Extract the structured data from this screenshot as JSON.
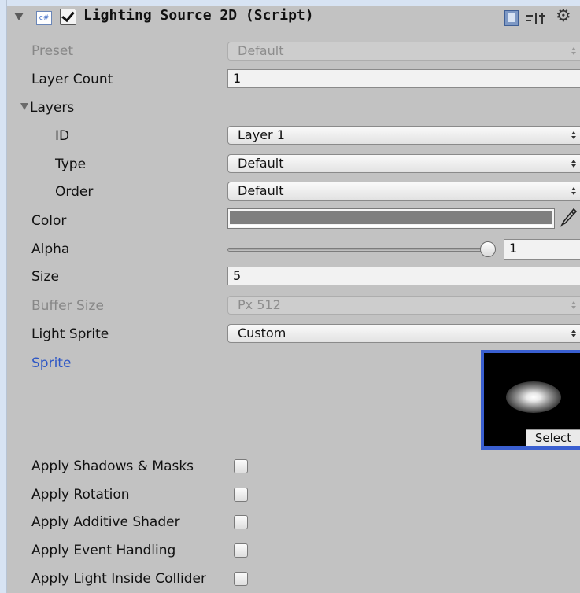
{
  "component": {
    "title": "Lighting Source 2D (Script)",
    "icon_text": "c#",
    "enabled": true
  },
  "fields": {
    "preset": {
      "label": "Preset",
      "value": "Default"
    },
    "layer_count": {
      "label": "Layer Count",
      "value": "1"
    },
    "layers": {
      "label": "Layers"
    },
    "id": {
      "label": "ID",
      "value": "Layer 1"
    },
    "type": {
      "label": "Type",
      "value": "Default"
    },
    "order": {
      "label": "Order",
      "value": "Default"
    },
    "color": {
      "label": "Color",
      "value": "#7f7f7f"
    },
    "alpha": {
      "label": "Alpha",
      "value": "1",
      "slider_fraction": 1.0
    },
    "size": {
      "label": "Size",
      "value": "5"
    },
    "buffer_size": {
      "label": "Buffer Size",
      "value": "Px 512"
    },
    "light_sprite": {
      "label": "Light Sprite",
      "value": "Custom"
    },
    "sprite": {
      "label": "Sprite",
      "select_label": "Select"
    }
  },
  "toggles": [
    {
      "label": "Apply Shadows & Masks",
      "checked": false
    },
    {
      "label": "Apply Rotation",
      "checked": false
    },
    {
      "label": "Apply Additive Shader",
      "checked": false
    },
    {
      "label": "Apply Event Handling",
      "checked": false
    },
    {
      "label": "Apply Light Inside Collider",
      "checked": false
    }
  ],
  "icons": [
    "foldout-arrow-icon",
    "script-icon",
    "help-icon",
    "preset-icon",
    "gear-icon",
    "color-picker-icon"
  ],
  "colors": {
    "accent_blue": "#2e57c5",
    "selection_border": "#3a5fd0"
  }
}
